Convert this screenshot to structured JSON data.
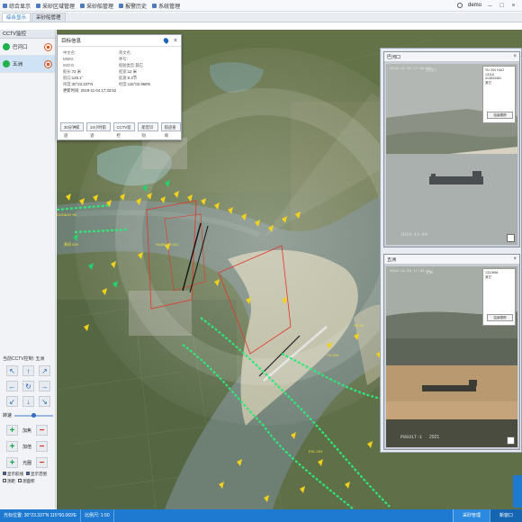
{
  "topbar": {
    "menu": [
      "综合显示",
      "采砂区域管理",
      "采砂船管理",
      "报警历史",
      "系统管理"
    ],
    "user": "demo"
  },
  "tabs": [
    "综合显示",
    "采砂船管理"
  ],
  "sidebar": {
    "title": "CCTV监控",
    "cameras": [
      {
        "label": "巴河口"
      },
      {
        "label": "五洲"
      }
    ]
  },
  "control": {
    "title": "当前CCTV控制: 五洲",
    "speed_label": "转速",
    "zoom_rows": [
      {
        "label": "加焦"
      },
      {
        "label": "加倍"
      },
      {
        "label": "光圈"
      }
    ],
    "checks": [
      {
        "label": "显示航线",
        "on": true
      },
      {
        "label": "显示范围",
        "on": true
      },
      {
        "label": "测距",
        "on": false
      },
      {
        "label": "测面积",
        "on": false
      }
    ]
  },
  "target_popup": {
    "title": "目标信息",
    "fields": [
      {
        "k": "中文名:",
        "v": ""
      },
      {
        "k": "英文名:",
        "v": ""
      },
      {
        "k": "MMSI:",
        "v": ""
      },
      {
        "k": "呼号:",
        "v": ""
      },
      {
        "k": "IMO:",
        "v": "0"
      },
      {
        "k": "船舶类型:",
        "v": "其它"
      },
      {
        "k": "船长:",
        "v": "72 米"
      },
      {
        "k": "船宽:",
        "v": "12 米"
      },
      {
        "k": "航向:",
        "v": "126.1°"
      },
      {
        "k": "航速:",
        "v": "0.3节"
      },
      {
        "k": "纬度:",
        "v": "30°23.337'N"
      },
      {
        "k": "经度:",
        "v": "115°02.969'E"
      }
    ],
    "update_time": "更新时间: 2019-11-04 17:33:52",
    "buttons": [
      "30分钟航迹",
      "24小时航迹",
      "CCTV监控",
      "船型识别",
      "航迹查询"
    ]
  },
  "videos": [
    {
      "title": "巴河口",
      "timestamp": "2019-11-04 17:33:52",
      "loc_overlay": "巴河口",
      "bottom_ts": "2019-11-04",
      "bottom_loc": "",
      "info": [
        "YU XIN HUO 13118",
        "413833481",
        "其它"
      ],
      "info_btn": "结束跟踪"
    },
    {
      "title": "五洲",
      "timestamp": "2019-11-04 17:33:52",
      "loc_overlay": "五洲",
      "bottom_ts": "P8931T-1",
      "bottom_loc": "2021",
      "info": [
        "133JH66",
        "其它"
      ],
      "info_btn": "结束跟踪"
    }
  ],
  "statusbar": {
    "coords": "光标位置: 30°23.337'N 115°00.069'E",
    "scale": "比例尺: 1:50",
    "btn1": "采砂管理",
    "btn2": "新窗口"
  },
  "colors": {
    "accent": "#1d7ad0",
    "ais_target": "#f2d21b",
    "ais_green": "#2ee87a",
    "zone": "#e4352b"
  }
}
